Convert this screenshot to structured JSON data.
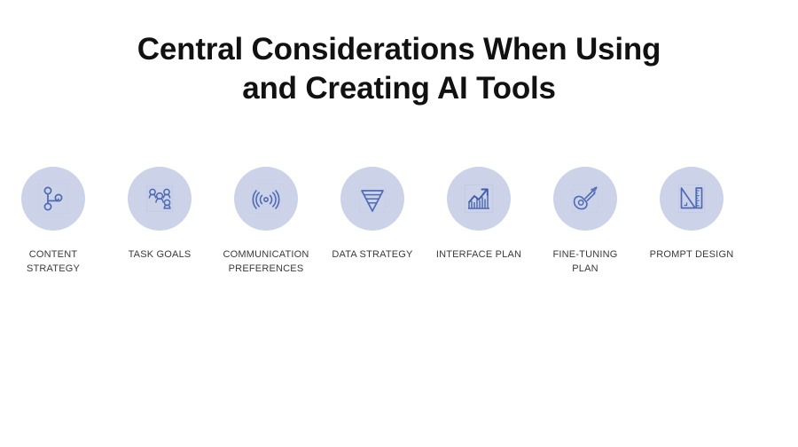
{
  "slide": {
    "title": "Central Considerations When Using\nand Creating AI Tools",
    "background_color": "#ffffff",
    "circle_color": "#ccd2e8",
    "icon_color": "#5b77bb",
    "title_color": "#111111",
    "label_color": "#3a3a3a",
    "items": [
      {
        "label": "CONTENT\nSTRATEGY",
        "icon": "node-graph-icon"
      },
      {
        "label": "TASK GOALS",
        "icon": "people-group-icon"
      },
      {
        "label": "COMMUNICATION\nPREFERENCES",
        "icon": "signal-waves-icon"
      },
      {
        "label": "DATA STRATEGY",
        "icon": "funnel-icon"
      },
      {
        "label": "INTERFACE PLAN",
        "icon": "growth-chart-icon"
      },
      {
        "label": "FINE-TUNING\nPLAN",
        "icon": "guitar-icon"
      },
      {
        "label": "PROMPT DESIGN",
        "icon": "ruler-set-square-icon"
      }
    ]
  }
}
